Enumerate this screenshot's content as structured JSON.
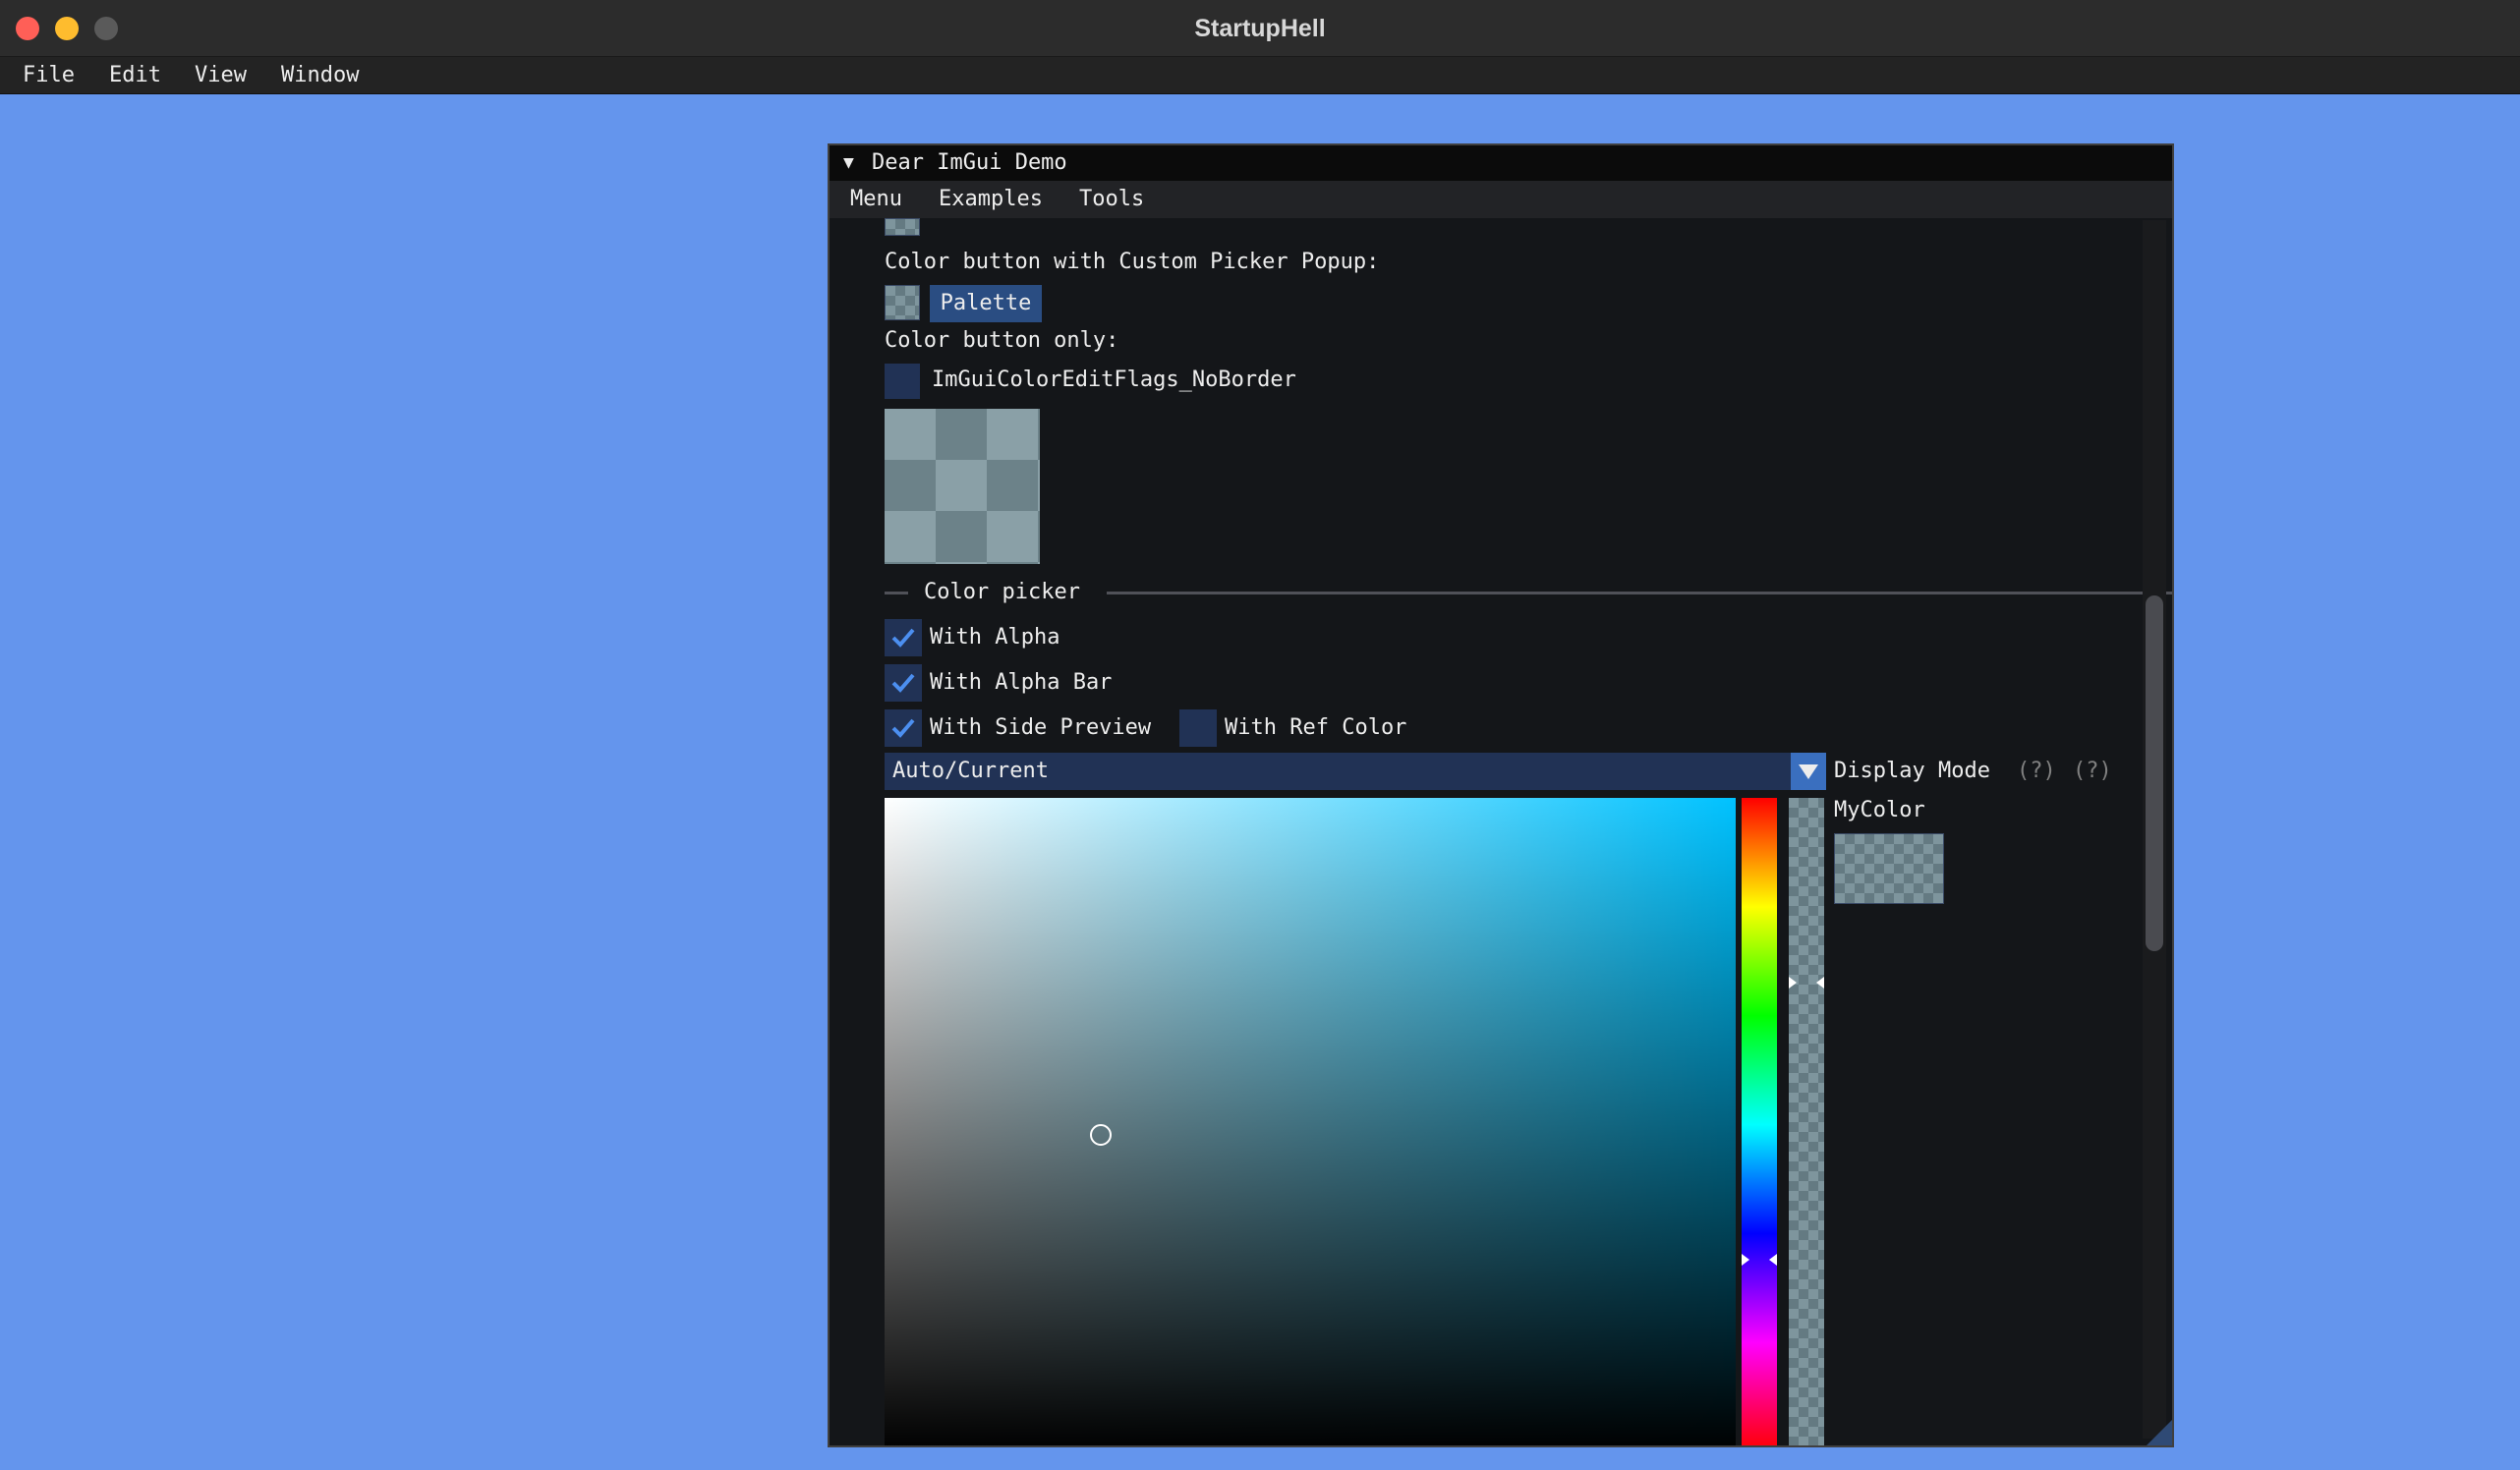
{
  "app": {
    "title": "StartupHell"
  },
  "host_menu": {
    "items": [
      "File",
      "Edit",
      "View",
      "Window"
    ]
  },
  "imgui_window": {
    "title": "Dear ImGui Demo",
    "menu": [
      "Menu",
      "Examples",
      "Tools"
    ]
  },
  "content": {
    "custom_picker_label": "Color button with Custom Picker Popup:",
    "palette_button": "Palette",
    "button_only_label": "Color button only:",
    "noborder_label": "ImGuiColorEditFlags_NoBorder",
    "section_title": "Color picker",
    "checkboxes": [
      {
        "label": "With Alpha",
        "checked": true
      },
      {
        "label": "With Alpha Bar",
        "checked": true
      },
      {
        "label": "With Side Preview",
        "checked": true
      },
      {
        "label": "With Ref Color",
        "checked": false
      }
    ],
    "display_mode": {
      "value": "Auto/Current",
      "label": "Display Mode",
      "help1": "(?)",
      "help2": "(?)"
    },
    "preview_label": "MyColor"
  },
  "colors": {
    "background": "#6495ED",
    "window_bg": "#141619",
    "frame_bg": "#213255",
    "accent": "#3A6FBF",
    "picker_hue": "#00C2FF"
  },
  "icons": [
    "close-light",
    "minimize-light",
    "maximize-light",
    "collapse-arrow-icon",
    "check-icon",
    "dropdown-arrow-icon",
    "picker-cursor-icon",
    "resize-grip-icon"
  ]
}
